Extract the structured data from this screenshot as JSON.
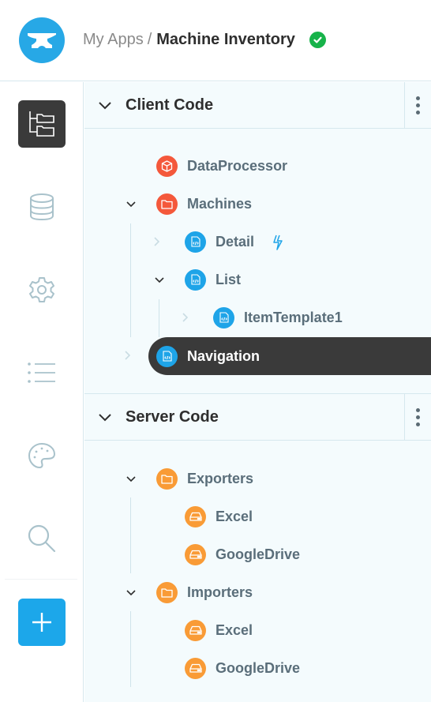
{
  "header": {
    "logo_icon": "anvil-icon",
    "breadcrumb_parent": "My Apps",
    "breadcrumb_separator": "/",
    "app_name": "Machine Inventory",
    "status_icon": "check-circle-icon",
    "status_color": "#17b34a"
  },
  "rail": {
    "items": [
      {
        "name": "code-tree",
        "icon": "folder-tree-icon",
        "active": true
      },
      {
        "name": "data",
        "icon": "database-icon",
        "active": false
      },
      {
        "name": "settings",
        "icon": "gear-icon",
        "active": false
      },
      {
        "name": "list",
        "icon": "list-icon",
        "active": false
      },
      {
        "name": "theme",
        "icon": "palette-icon",
        "active": false
      },
      {
        "name": "search",
        "icon": "search-icon",
        "active": false
      },
      {
        "name": "add",
        "icon": "plus-icon",
        "active": false
      }
    ]
  },
  "client_code": {
    "title": "Client Code",
    "items": [
      {
        "label": "DataProcessor",
        "icon": "package-icon",
        "type": "module"
      },
      {
        "label": "Machines",
        "icon": "folder-icon",
        "type": "folder",
        "expanded": true
      },
      {
        "label": "Detail",
        "icon": "form-icon",
        "type": "form",
        "expanded": false,
        "badge": "lightning-icon"
      },
      {
        "label": "List",
        "icon": "form-icon",
        "type": "form",
        "expanded": true
      },
      {
        "label": "ItemTemplate1",
        "icon": "form-icon",
        "type": "form",
        "expanded": false
      },
      {
        "label": "Navigation",
        "icon": "form-icon",
        "type": "form",
        "expanded": false,
        "selected": true
      }
    ]
  },
  "server_code": {
    "title": "Server Code",
    "items": [
      {
        "label": "Exporters",
        "icon": "folder-icon",
        "type": "folder",
        "expanded": true
      },
      {
        "label": "Excel",
        "icon": "server-icon",
        "type": "server-module"
      },
      {
        "label": "GoogleDrive",
        "icon": "server-icon",
        "type": "server-module"
      },
      {
        "label": "Importers",
        "icon": "folder-icon",
        "type": "folder",
        "expanded": true
      },
      {
        "label": "Excel",
        "icon": "server-icon",
        "type": "server-module"
      },
      {
        "label": "GoogleDrive",
        "icon": "server-icon",
        "type": "server-module"
      }
    ]
  },
  "colors": {
    "accent": "#1ca7ea",
    "client_module": "#f4583b",
    "form": "#1ea4e8",
    "server": "#f99b36",
    "selected_bg": "#3a3a3a"
  }
}
